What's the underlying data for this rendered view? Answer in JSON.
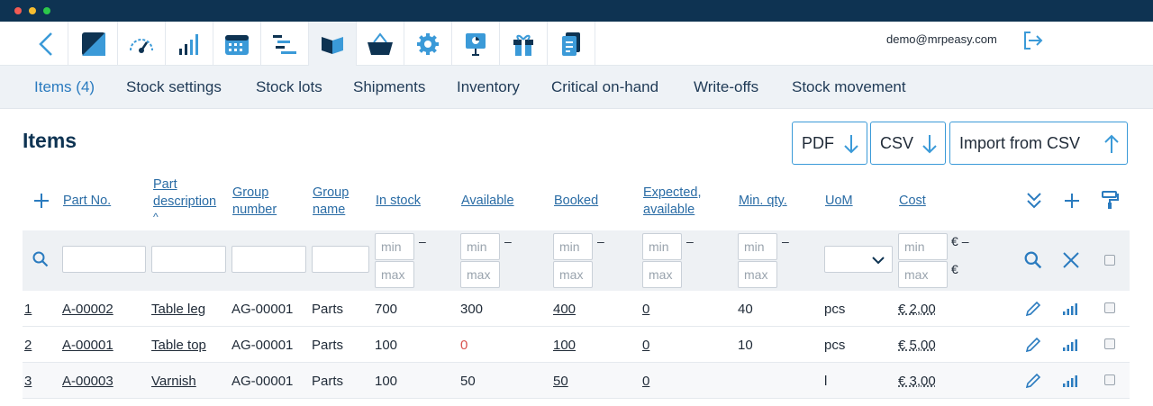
{
  "window": {
    "accent": "#0e3352"
  },
  "user": {
    "email": "demo@mrpeasy.com"
  },
  "nav": {
    "icons": [
      "back-icon",
      "dashboard-logo-icon",
      "speedometer-icon",
      "signal-bars-icon",
      "calendar-icon",
      "gantt-icon",
      "book-icon",
      "basket-icon",
      "gear-icon",
      "presentation-icon",
      "gift-icon",
      "document-icon",
      "logout-icon"
    ]
  },
  "subnav": {
    "tabs": [
      "Items (4)",
      "Stock settings",
      "Stock lots",
      "Shipments",
      "Inventory",
      "Critical on-hand",
      "Write-offs",
      "Stock movement"
    ]
  },
  "page": {
    "title": "Items"
  },
  "buttons": {
    "pdf": "PDF",
    "csv": "CSV",
    "import": "Import from CSV"
  },
  "table": {
    "headers": {
      "part_no": "Part No.",
      "part_desc_1": "Part",
      "part_desc_2": "description",
      "sort_caret": "^",
      "group_number_1": "Group",
      "group_number_2": "number",
      "group_name_1": "Group",
      "group_name_2": "name",
      "in_stock": "In stock",
      "available": "Available",
      "booked": "Booked",
      "expected_1": "Expected,",
      "expected_2": "available",
      "min_qty": "Min. qty.",
      "uom": "UoM",
      "cost": "Cost"
    },
    "filters": {
      "min": "min",
      "max": "max",
      "dash": "–",
      "currency": "€"
    },
    "rows": [
      {
        "num": "1",
        "part_no": "A-00002",
        "desc": "Table leg",
        "group_number": "AG-00001",
        "group_name": "Parts",
        "in_stock": "700",
        "available": "300",
        "booked": "400",
        "expected": "0",
        "min_qty": "40",
        "uom": "pcs",
        "cost": "€ 2,00"
      },
      {
        "num": "2",
        "part_no": "A-00001",
        "desc": "Table top",
        "group_number": "AG-00001",
        "group_name": "Parts",
        "in_stock": "100",
        "available": "0",
        "booked": "100",
        "expected": "0",
        "min_qty": "10",
        "uom": "pcs",
        "cost": "€ 5,00"
      },
      {
        "num": "3",
        "part_no": "A-00003",
        "desc": "Varnish",
        "group_number": "AG-00001",
        "group_name": "Parts",
        "in_stock": "100",
        "available": "50",
        "booked": "50",
        "expected": "0",
        "min_qty": "",
        "uom": "l",
        "cost": "€ 3,00"
      }
    ]
  }
}
